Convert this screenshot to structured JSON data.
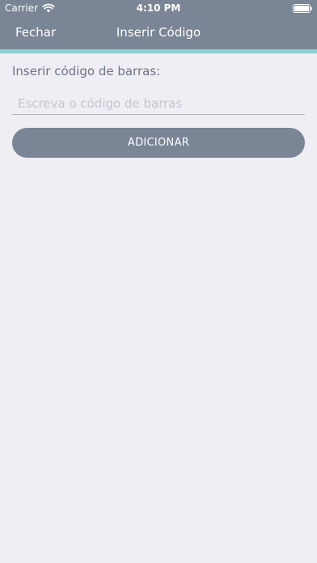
{
  "status_bar": {
    "carrier": "Carrier",
    "time": "4:10 PM",
    "wifi_icon": "wifi-icon",
    "battery_icon": "battery-icon"
  },
  "nav": {
    "close_label": "Fechar",
    "title": "Inserir Código"
  },
  "form": {
    "label": "Inserir código de barras:",
    "input_value": "",
    "input_placeholder": "Escreva o código de barras",
    "submit_label": "ADICIONAR"
  },
  "colors": {
    "header_bg": "#7a8596",
    "accent": "#8ecfd0",
    "page_bg": "#efeef3",
    "label_text": "#6a7587",
    "button_bg": "#7a8596"
  }
}
